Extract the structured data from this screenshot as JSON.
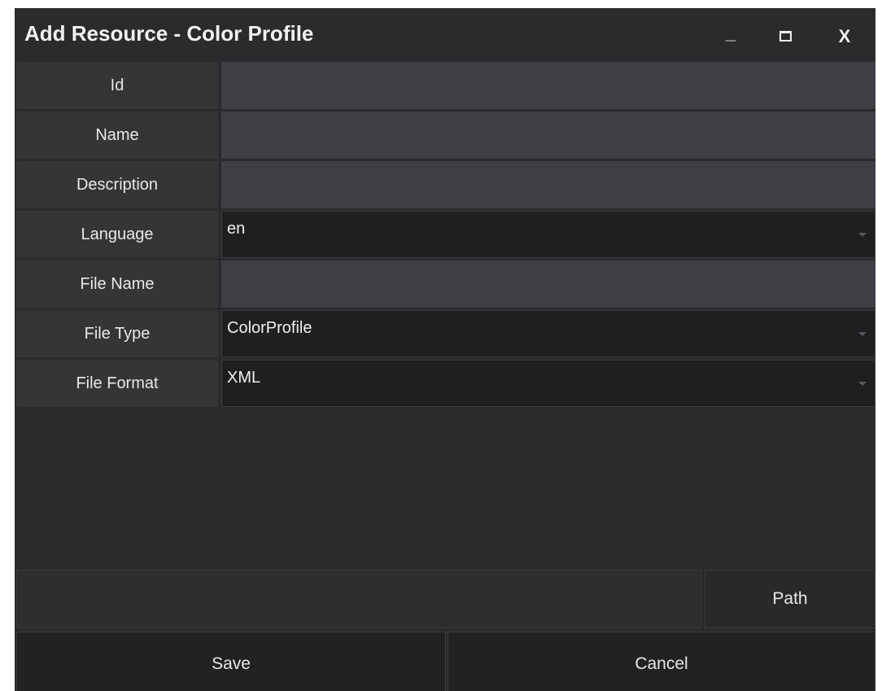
{
  "window": {
    "title": "Add Resource - Color Profile",
    "minimize_label": "_",
    "close_label": "X"
  },
  "form": {
    "fields": [
      {
        "label": "Id",
        "value": ""
      },
      {
        "label": "Name",
        "value": ""
      },
      {
        "label": "Description",
        "value": ""
      },
      {
        "label": "Language",
        "value": "en"
      },
      {
        "label": "File Name",
        "value": ""
      },
      {
        "label": "File Type",
        "value": "ColorProfile"
      },
      {
        "label": "File Format",
        "value": "XML"
      }
    ]
  },
  "path": {
    "value": "",
    "button_label": "Path"
  },
  "actions": {
    "save_label": "Save",
    "cancel_label": "Cancel"
  }
}
